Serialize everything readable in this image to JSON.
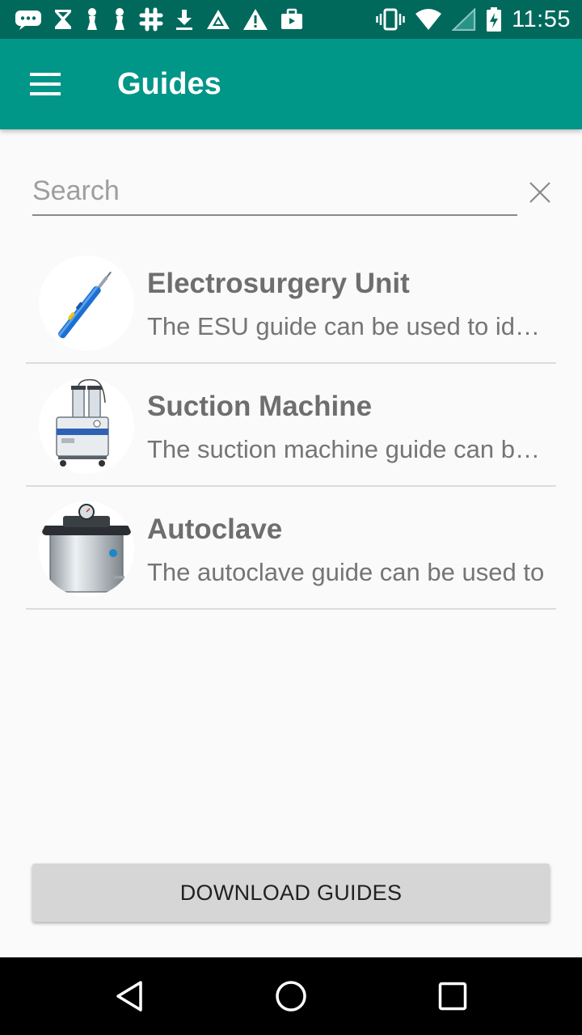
{
  "status_bar": {
    "time": "11:55",
    "icons": [
      "messages-icon",
      "hourglass-icon",
      "chess-pawn-icon",
      "chess-pawn-icon",
      "slack-icon",
      "download-icon",
      "triangle-app-icon",
      "warning-icon",
      "work-bag-icon",
      "vibrate-icon",
      "wifi-icon",
      "signal-icon",
      "battery-charging-icon"
    ]
  },
  "app_bar": {
    "title": "Guides",
    "menu_icon": "hamburger-menu-icon"
  },
  "search": {
    "placeholder": "Search",
    "value": "",
    "clear_icon": "close-icon"
  },
  "guides": [
    {
      "title": "Electrosurgery Unit",
      "description": "The ESU guide can be used to identify",
      "image": "electrosurgery-pen"
    },
    {
      "title": "Suction Machine",
      "description": "The suction machine guide can be used",
      "image": "suction-machine"
    },
    {
      "title": "Autoclave",
      "description": "The autoclave guide can be used to",
      "image": "autoclave"
    }
  ],
  "download_button": {
    "label": "DOWNLOAD GUIDES"
  },
  "nav_bar": {
    "back_icon": "back-triangle-icon",
    "home_icon": "home-circle-icon",
    "recents_icon": "recents-square-icon"
  },
  "colors": {
    "primary": "#009688",
    "primary_dark": "#00695c",
    "background": "#fafafa",
    "button": "#d6d6d6"
  }
}
